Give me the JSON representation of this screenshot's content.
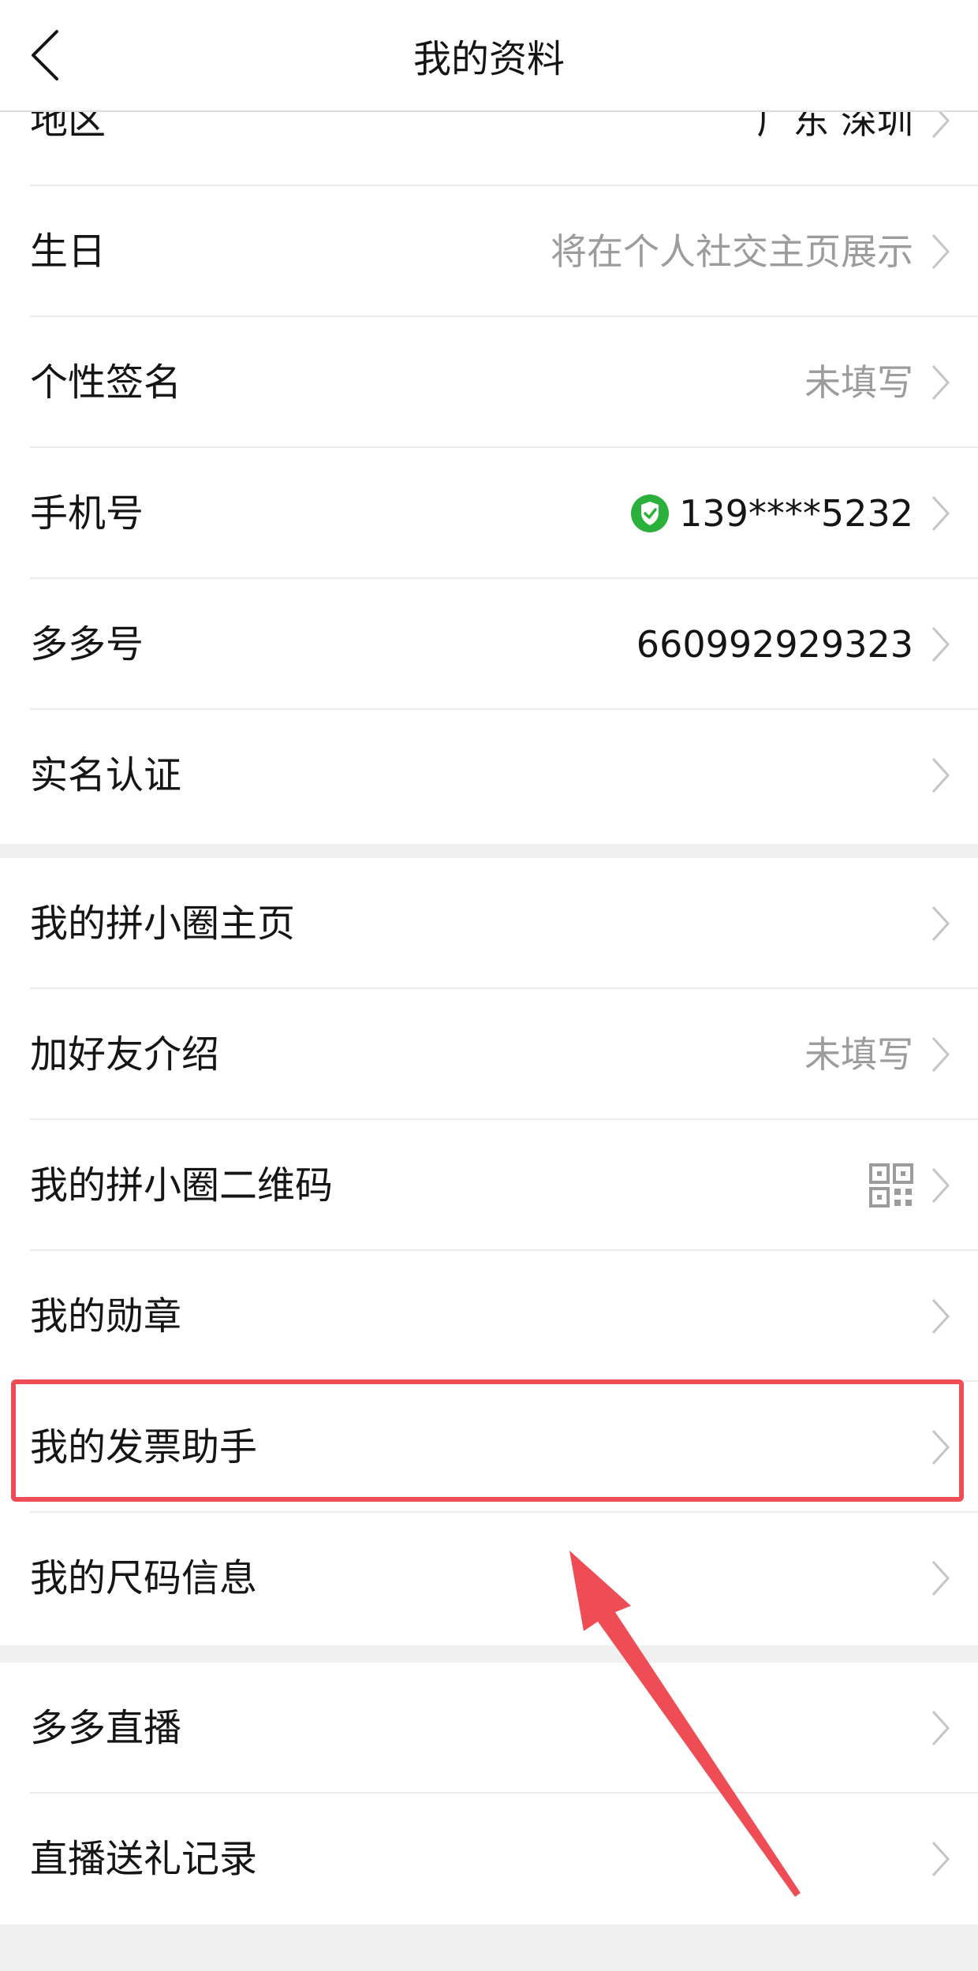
{
  "header": {
    "title": "我的资料"
  },
  "group1": [
    {
      "label": "地区",
      "value": "广东 深圳"
    },
    {
      "label": "生日",
      "value": "将在个人社交主页展示"
    },
    {
      "label": "个性签名",
      "value": "未填写"
    },
    {
      "label": "手机号",
      "value": "139****5232"
    },
    {
      "label": "多多号",
      "value": "660992929323"
    },
    {
      "label": "实名认证",
      "value": ""
    }
  ],
  "group2": [
    {
      "label": "我的拼小圈主页",
      "value": ""
    },
    {
      "label": "加好友介绍",
      "value": "未填写"
    },
    {
      "label": "我的拼小圈二维码",
      "value": ""
    },
    {
      "label": "我的勋章",
      "value": ""
    },
    {
      "label": "我的发票助手",
      "value": ""
    },
    {
      "label": "我的尺码信息",
      "value": ""
    }
  ],
  "group3": [
    {
      "label": "多多直播",
      "value": ""
    },
    {
      "label": "直播送礼记录",
      "value": ""
    }
  ],
  "icons": {
    "back": "chevron-left-icon",
    "verified": "shield-check-icon",
    "qr": "qr-code-icon",
    "chevron": "chevron-right-icon"
  },
  "colors": {
    "highlight": "#ee4d55",
    "verified": "#2bb13b",
    "background": "#f0f0f0"
  }
}
